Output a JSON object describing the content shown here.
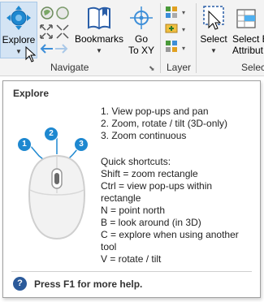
{
  "ribbon": {
    "groups": {
      "navigate": "Navigate",
      "layer": "Layer",
      "selection": "Selec"
    },
    "buttons": {
      "explore": "Explore",
      "bookmarks": "Bookmarks",
      "goto_line1": "Go",
      "goto_line2": "To XY",
      "select": "Select",
      "select_by_attr_line1": "Select B",
      "select_by_attr_line2": "Attribut"
    }
  },
  "tooltip": {
    "title": "Explore",
    "actions": "1. View pop-ups and pan\n2. Zoom, rotate / tilt (3D-only)\n3. Zoom continuous",
    "shortcuts": "Quick shortcuts:\nShift = zoom rectangle\nCtrl = view pop-ups within rectangle\nN = point north\nB = look around (in 3D)\nC = explore when using another tool\nV = rotate / tilt",
    "badges": [
      "1",
      "2",
      "3"
    ],
    "help_icon": "?",
    "help_text": "Press F1 for more help."
  },
  "colors": {
    "accent": "#1e88d0",
    "explore_button_bg": "#d4e4f4",
    "help_icon_bg": "#2b5a9a"
  },
  "icons": [
    "explore-icon",
    "full-extent-icon",
    "fixed-zoom-icon",
    "previous-extent-icon",
    "next-extent-icon",
    "bookmarks-icon",
    "goto-xy-icon",
    "layer-icon",
    "select-icon",
    "select-by-attributes-icon",
    "dialog-launcher-icon",
    "cursor-icon",
    "mouse-icon",
    "help-icon"
  ]
}
